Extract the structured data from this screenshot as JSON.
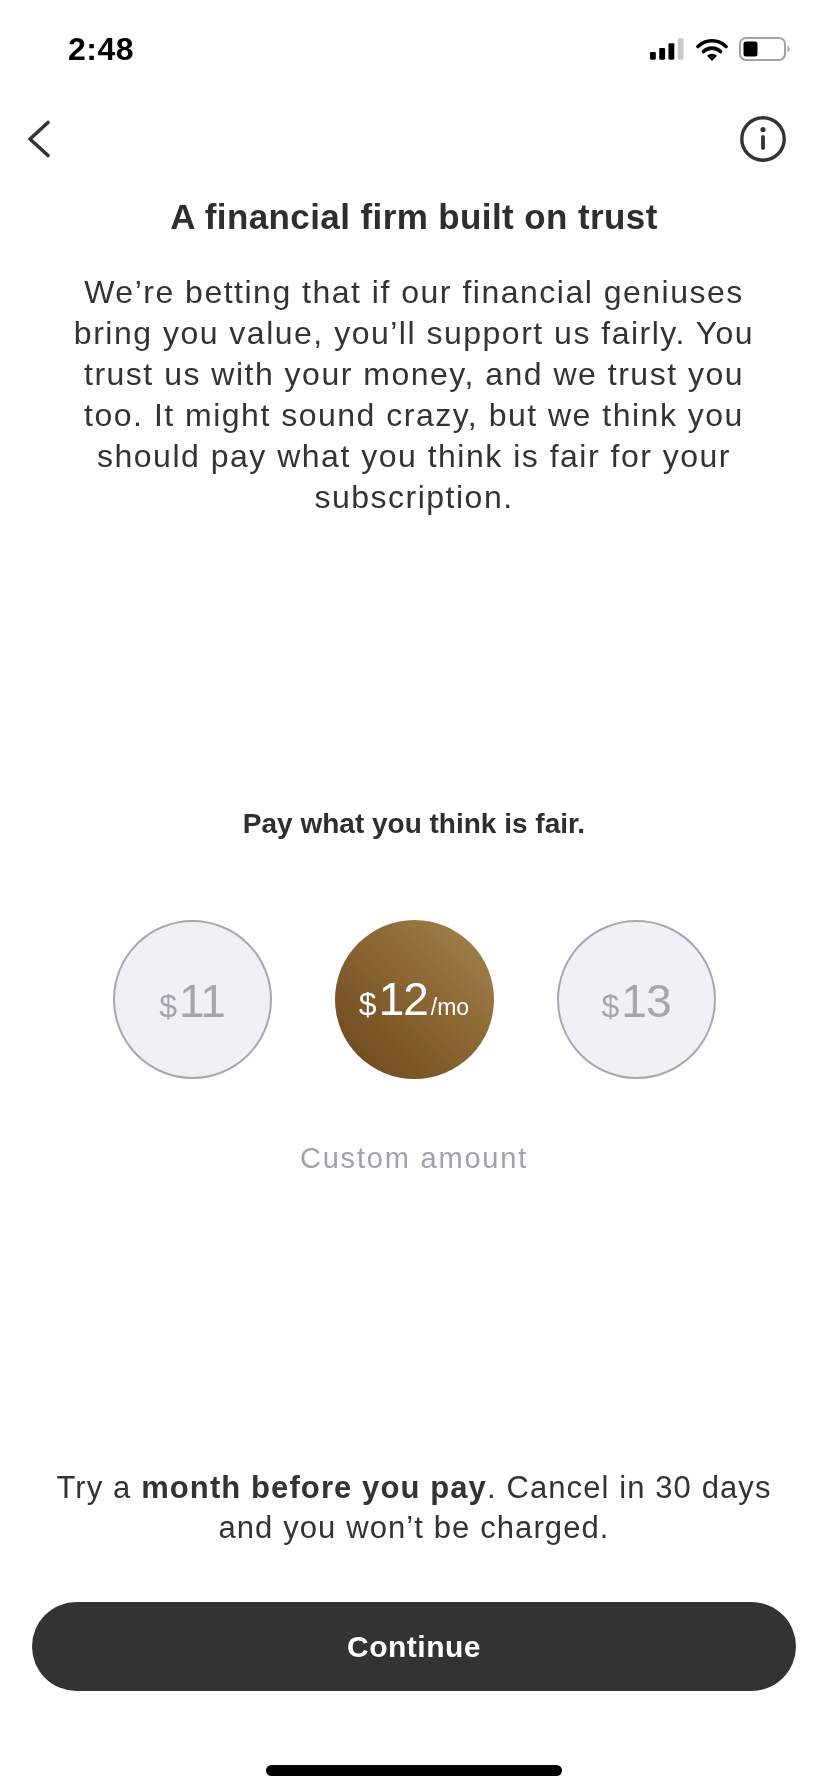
{
  "status_bar": {
    "time": "2:48"
  },
  "title": "A financial firm built on trust",
  "description": "We’re betting that if our financial geniuses bring you value, you’ll support us fairly. You trust us with your money, and we trust you too. It might sound crazy, but we think you should pay what you think is fair for your subscription.",
  "pricing": {
    "heading": "Pay what you think is fair.",
    "options": [
      {
        "currency": "$",
        "amount": "11",
        "selected": false
      },
      {
        "currency": "$",
        "amount": "12",
        "period": "/mo",
        "selected": true
      },
      {
        "currency": "$",
        "amount": "13",
        "selected": false
      }
    ],
    "custom_amount": "Custom amount"
  },
  "trial_note": "Try a **month before you pay**. Cancel in 30 days and you won’t be charged.",
  "continue_button": "Continue"
}
